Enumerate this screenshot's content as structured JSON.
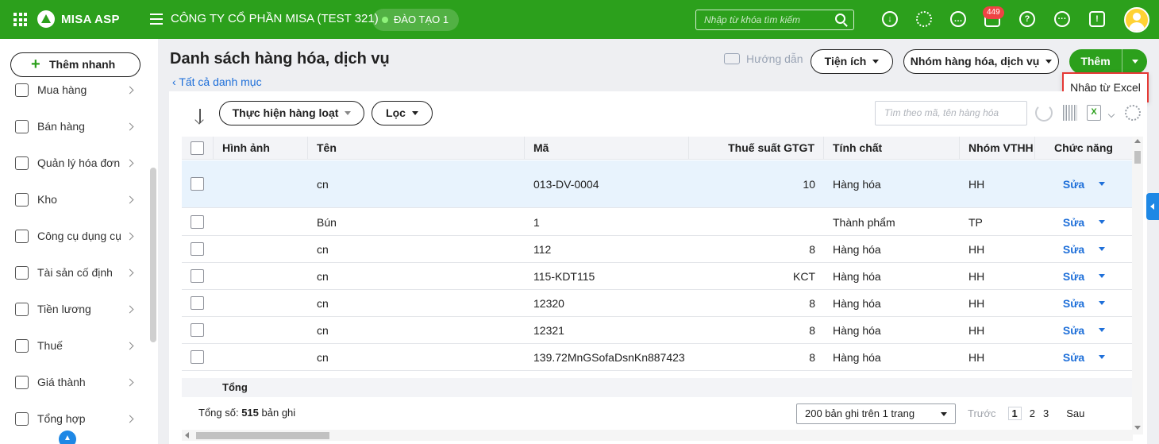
{
  "topbar": {
    "brand": "MISA ASP",
    "company": "CÔNG TY CỔ PHẦN MISA (TEST 321)",
    "env_label": "ĐÀO TẠO 1",
    "search_placeholder": "Nhập từ khóa tìm kiếm",
    "notification_count": "449",
    "accent_color": "#2ca01c"
  },
  "sidebar": {
    "quick_add": "Thêm nhanh",
    "items": [
      {
        "label": "Mua hàng",
        "icon": "shopping-bag-icon"
      },
      {
        "label": "Bán hàng",
        "icon": "cart-icon"
      },
      {
        "label": "Quản lý hóa đơn",
        "icon": "invoice-icon"
      },
      {
        "label": "Kho",
        "icon": "warehouse-icon"
      },
      {
        "label": "Công cụ dụng cụ",
        "icon": "tools-icon"
      },
      {
        "label": "Tài sản cố định",
        "icon": "car-icon"
      },
      {
        "label": "Tiền lương",
        "icon": "salary-icon"
      },
      {
        "label": "Thuế",
        "icon": "tax-icon"
      },
      {
        "label": "Giá thành",
        "icon": "price-tag-icon"
      },
      {
        "label": "Tổng hợp",
        "icon": "summary-book-icon"
      }
    ]
  },
  "page": {
    "title": "Danh sách hàng hóa, dịch vụ",
    "back_link": "Tất cả danh mục",
    "guide": "Hướng dẫn",
    "utilities": "Tiện ích",
    "group_button": "Nhóm hàng hóa, dịch vụ",
    "add_button": "Thêm",
    "dropdown_item": "Nhập từ Excel"
  },
  "toolbar": {
    "bulk_action": "Thực hiện hàng loạt",
    "filter": "Lọc",
    "search_placeholder": "Tìm theo mã, tên hàng hóa"
  },
  "table": {
    "columns": [
      "Hình ảnh",
      "Tên",
      "Mã",
      "Thuế suất GTGT",
      "Tính chất",
      "Nhóm VTHH",
      "Chức năng"
    ],
    "rows": [
      {
        "name": "cn",
        "code": "013-DV-0004",
        "vat": "10",
        "nature": "Hàng hóa",
        "group": "HH",
        "action": "Sửa"
      },
      {
        "name": "Bún",
        "code": "1",
        "vat": "",
        "nature": "Thành phẩm",
        "group": "TP",
        "action": "Sửa"
      },
      {
        "name": "cn",
        "code": "112",
        "vat": "8",
        "nature": "Hàng hóa",
        "group": "HH",
        "action": "Sửa"
      },
      {
        "name": "cn",
        "code": "115-KDT115",
        "vat": "KCT",
        "nature": "Hàng hóa",
        "group": "HH",
        "action": "Sửa"
      },
      {
        "name": "cn",
        "code": "12320",
        "vat": "8",
        "nature": "Hàng hóa",
        "group": "HH",
        "action": "Sửa"
      },
      {
        "name": "cn",
        "code": "12321",
        "vat": "8",
        "nature": "Hàng hóa",
        "group": "HH",
        "action": "Sửa"
      },
      {
        "name": "cn",
        "code": "139.72MnGSofaDsnKn887423",
        "vat": "8",
        "nature": "Hàng hóa",
        "group": "HH",
        "action": "Sửa"
      }
    ],
    "total_label": "Tổng"
  },
  "footer": {
    "count_prefix": "Tổng số: ",
    "count_value": "515",
    "count_suffix": " bản ghi",
    "page_size": "200 bản ghi trên 1 trang",
    "prev": "Trước",
    "pages": [
      "1",
      "2",
      "3"
    ],
    "next": "Sau"
  }
}
